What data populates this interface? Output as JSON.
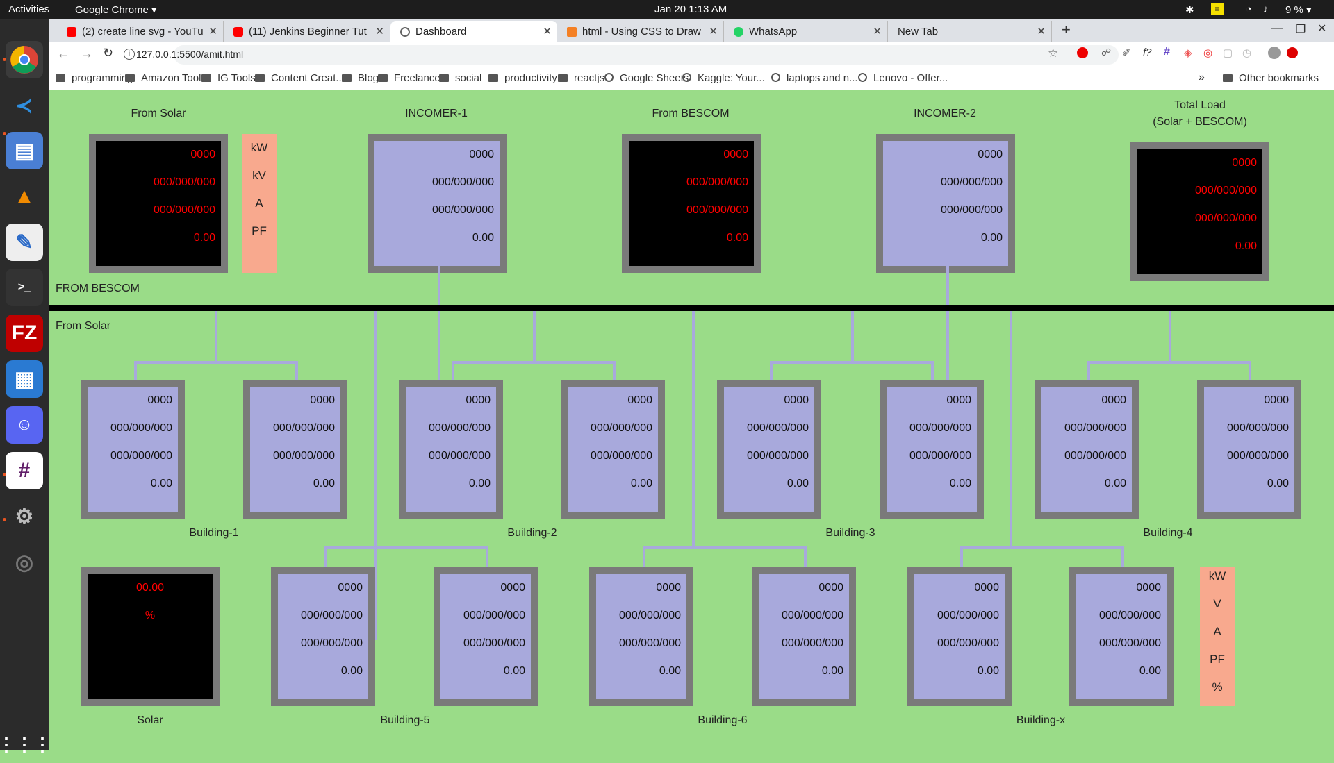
{
  "system_bar": {
    "activities": "Activities",
    "app": "Google Chrome",
    "clock": "Jan 20  1:13 AM",
    "battery": "9 %"
  },
  "tabs": [
    {
      "title": "(2) create line svg - YouTu",
      "icon": "youtube-icon",
      "color": "#ff0000"
    },
    {
      "title": "(11) Jenkins Beginner Tut",
      "icon": "youtube-icon",
      "color": "#ff0000"
    },
    {
      "title": "Dashboard",
      "icon": "globe-icon",
      "color": "#666666"
    },
    {
      "title": "html - Using CSS to Draw",
      "icon": "stackoverflow-icon",
      "color": "#f48024"
    },
    {
      "title": "WhatsApp",
      "icon": "whatsapp-icon",
      "color": "#25d366"
    },
    {
      "title": "New Tab",
      "icon": "",
      "color": ""
    }
  ],
  "url": "127.0.0.1:5500/amit.html",
  "bookmarks": [
    "programming",
    "Amazon Tools",
    "IG Tools",
    "Content Creat...",
    "Blog",
    "Freelance",
    "social",
    "productivity",
    "reactjs",
    "Google Sheets",
    "Kaggle: Your...",
    "laptops and n...",
    "Lenovo - Offer...",
    "Other bookmarks"
  ],
  "dashboard": {
    "headers": {
      "from_solar": "From Solar",
      "incomer1": "INCOMER-1",
      "from_bescom": "From BESCOM",
      "incomer2": "INCOMER-2",
      "total_line1": "Total Load",
      "total_line2": "(Solar + BESCOM)"
    },
    "bus_labels": {
      "bescom": "FROM BESCOM",
      "solar": "From Solar"
    },
    "meter_values": {
      "v1": "0000",
      "v2": "000/000/000",
      "v3": "000/000/000",
      "v4": "0.00"
    },
    "solar_meter": {
      "v1": "00.00",
      "v2": "%"
    },
    "units_top": [
      "kW",
      "kV",
      "A",
      "PF"
    ],
    "units_bottom": [
      "kW",
      "V",
      "A",
      "PF",
      "%"
    ],
    "buildings": [
      "Building-1",
      "Building-2",
      "Building-3",
      "Building-4",
      "Building-5",
      "Building-6",
      "Building-x"
    ],
    "solar_label": "Solar"
  }
}
